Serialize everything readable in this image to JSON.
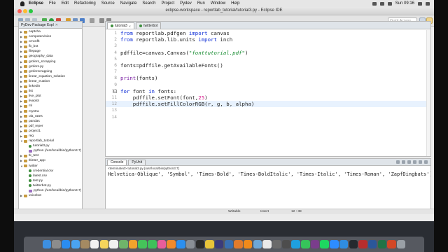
{
  "menubar": {
    "items": [
      "Eclipse",
      "File",
      "Edit",
      "Refactoring",
      "Source",
      "Navigate",
      "Search",
      "Project",
      "Pydev",
      "Run",
      "Window",
      "Help"
    ],
    "clock": "Sun 09:16"
  },
  "window": {
    "title": "eclipse-workspace - reportlab_tutorial/tutorial3.py - Eclipse IDE"
  },
  "toolbar": {
    "quick_access_placeholder": "Quick Access"
  },
  "explorer": {
    "tab_label": "PyDev Package Expl",
    "items": [
      {
        "label": "captcha",
        "indent": 0,
        "type": "folder"
      },
      {
        "label": "computervision",
        "indent": 0,
        "type": "folder"
      },
      {
        "label": "crncnflt",
        "indent": 0,
        "type": "folder"
      },
      {
        "label": "fb_bot",
        "indent": 0,
        "type": "folder"
      },
      {
        "label": "filepage",
        "indent": 0,
        "type": "folder"
      },
      {
        "label": "geography_data",
        "indent": 0,
        "type": "folder"
      },
      {
        "label": "grofers_scrapping",
        "indent": 0,
        "type": "folder"
      },
      {
        "label": "grofers.py",
        "indent": 0,
        "type": "folder"
      },
      {
        "label": "groferscrapping",
        "indent": 0,
        "type": "folder"
      },
      {
        "label": "linear_equation_solution",
        "indent": 0,
        "type": "folder"
      },
      {
        "label": "linear_euation",
        "indent": 0,
        "type": "folder"
      },
      {
        "label": "linkedin",
        "indent": 0,
        "type": "folder"
      },
      {
        "label": "list",
        "indent": 0,
        "type": "folder"
      },
      {
        "label": "live_plot",
        "indent": 0,
        "type": "folder"
      },
      {
        "label": "liveplot",
        "indent": 0,
        "type": "folder"
      },
      {
        "label": "ml",
        "indent": 0,
        "type": "folder"
      },
      {
        "label": "myntra",
        "indent": 0,
        "type": "folder"
      },
      {
        "label": "ola_rates",
        "indent": 0,
        "type": "folder"
      },
      {
        "label": "pandas",
        "indent": 0,
        "type": "folder"
      },
      {
        "label": "pdf_reper",
        "indent": 0,
        "type": "folder"
      },
      {
        "label": "project1",
        "indent": 0,
        "type": "folder"
      },
      {
        "label": "reg",
        "indent": 0,
        "type": "folder"
      },
      {
        "label": "reportlab_tutorial",
        "indent": 0,
        "type": "folder",
        "open": true
      },
      {
        "label": "tutorial3.py",
        "indent": 1,
        "type": "file"
      },
      {
        "label": "python  (/usr/local/bin/python3.7)",
        "indent": 1,
        "type": "lib"
      },
      {
        "label": "tk_test",
        "indent": 0,
        "type": "folder"
      },
      {
        "label": "tkinter_app",
        "indent": 0,
        "type": "folder"
      },
      {
        "label": "twitter",
        "indent": 0,
        "type": "folder",
        "open": true
      },
      {
        "label": "credential.csv",
        "indent": 1,
        "type": "file"
      },
      {
        "label": "latest.csv",
        "indent": 1,
        "type": "file"
      },
      {
        "label": "test.py",
        "indent": 1,
        "type": "file"
      },
      {
        "label": "twitterbot.py",
        "indent": 1,
        "type": "file"
      },
      {
        "label": "python  (/usr/local/bin/python3.7)",
        "indent": 1,
        "type": "lib"
      },
      {
        "label": "voicebot",
        "indent": 0,
        "type": "folder"
      }
    ]
  },
  "editor": {
    "tabs": [
      {
        "label": "tutorial3",
        "active": true
      },
      {
        "label": "twitterbot",
        "active": false
      }
    ],
    "lines": [
      {
        "n": "1",
        "text": "from reportlab.pdfgen import canvas"
      },
      {
        "n": "2",
        "text": "from reportlab.lib.units import inch"
      },
      {
        "n": "3",
        "text": ""
      },
      {
        "n": "4",
        "text": "pdffile=canvas.Canvas(\"fonttutorial.pdf\")"
      },
      {
        "n": "5",
        "text": ""
      },
      {
        "n": "6",
        "text": "fonts=pdffile.getAvailableFonts()"
      },
      {
        "n": "7",
        "text": ""
      },
      {
        "n": "8",
        "text": "print(fonts)"
      },
      {
        "n": "9",
        "text": ""
      },
      {
        "n": "10",
        "text": "for font in fonts:"
      },
      {
        "n": "11",
        "text": "    pdffile.setFont(font,25)"
      },
      {
        "n": "12",
        "text": "    pdffile.setFillColorRGB(r, g, b, alpha)"
      },
      {
        "n": "13",
        "text": ""
      },
      {
        "n": "14",
        "text": ""
      }
    ]
  },
  "console": {
    "tabs": [
      {
        "label": "Console",
        "active": true
      },
      {
        "label": "PyUnit",
        "active": false
      }
    ],
    "terminated": "<terminated> tutorial3.py [/usr/local/bin/python3.7]",
    "output": "Helvetica-Oblique', 'Symbol', 'Times-Bold', 'Times-BoldItalic', 'Times-Italic', 'Times-Roman', 'ZapfDingbats']"
  },
  "statusbar": {
    "mode": "Writable",
    "insert": "Insert",
    "position": "12 : 38"
  }
}
